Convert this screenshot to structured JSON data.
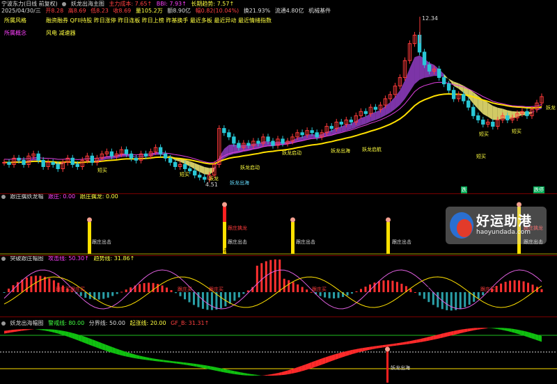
{
  "main": {
    "title_row1": [
      "宁波东力(日线 前复权)",
      "妖龙出海主图",
      "主力成本: 7.65↑",
      "BBI: 7.93↑",
      "长期趋势: 7.57↑"
    ],
    "title_row2": [
      "2025/04/30/三",
      "开8.28",
      "高8.69",
      "低8.23",
      "收8.69",
      "量105.2万",
      "额8.90亿",
      "幅0.82(10.04%)",
      "换21.93%",
      "流通4.80亿",
      "机械基件"
    ],
    "info_labels": [
      "所属风格",
      "所属概念"
    ],
    "style_text": "融资融券 QFII持股 昨日涨停 昨日连板 昨日上榜 昨基换手 最近多板 最近异动 最近情绪指数",
    "concept_text": "风电 减速器",
    "high_label": "12.34",
    "low_label": "4.51",
    "signal_labels": [
      "妖龙出海",
      "妖龙启动",
      "妖龙出海",
      "妖龙启动",
      "妖龙启航",
      "短买",
      "短买",
      "短买",
      "短买",
      "短买",
      "妖龙",
      "妖龙"
    ],
    "bottom_tags": [
      "跌",
      "跌停"
    ],
    "colors": {
      "up": "#ff3b3b",
      "down": "#29c7d6",
      "ma_yellow": "#ffe000",
      "ma_pink": "#e040e0",
      "ribbon_purple": "#8a3ab9",
      "ribbon_yellow": "#e8e070"
    },
    "chart_data": {
      "type": "candlestick",
      "close": [
        5.6,
        5.5,
        5.8,
        5.7,
        5.5,
        5.9,
        6.0,
        5.7,
        5.4,
        5.6,
        5.5,
        5.3,
        5.6,
        5.8,
        5.5,
        5.4,
        5.7,
        5.9,
        5.6,
        5.8,
        6.0,
        6.1,
        5.9,
        6.0,
        6.2,
        6.0,
        5.8,
        5.7,
        6.0,
        5.9,
        6.1,
        6.3,
        6.0,
        5.8,
        5.6,
        5.4,
        5.5,
        5.3,
        5.2,
        5.0,
        4.9,
        4.8,
        5.0,
        5.5,
        7.2,
        7.0,
        6.8,
        6.5,
        6.3,
        6.5,
        6.4,
        6.6,
        6.5,
        6.8,
        6.6,
        6.4,
        6.7,
        6.5,
        6.6,
        6.8,
        7.0,
        6.9,
        7.1,
        7.0,
        6.8,
        7.0,
        7.3,
        7.2,
        7.5,
        7.4,
        7.6,
        7.5,
        7.8,
        8.0,
        7.9,
        8.2,
        8.1,
        8.3,
        8.6,
        8.8,
        9.2,
        9.6,
        10.4,
        11.2,
        11.6,
        10.8,
        10.2,
        9.9,
        10.0,
        9.6,
        9.3,
        9.0,
        8.6,
        8.8,
        8.5,
        8.2,
        7.8,
        7.6,
        7.4,
        7.5,
        7.3,
        7.6,
        7.8,
        7.6,
        7.7,
        7.9,
        8.0,
        7.8,
        8.1,
        8.4,
        8.7
      ]
    }
  },
  "pane2": {
    "title": "跟庄擒妖龙幅",
    "fields": [
      "跟庄: 0.00",
      "跟庄擒龙: 0.00"
    ],
    "labels": [
      "跟庄出击",
      "跟庄出击",
      "跟庄出击",
      "跟庄出击",
      "跟庄出击",
      "跟庄出击"
    ],
    "labels_red": [
      "跟庄擒龙",
      "跟庄擒龙"
    ]
  },
  "pane3": {
    "title": "突破跟庄幅图",
    "fields": [
      "攻击线: 50.30↑",
      "趋势线: 31.86↑"
    ],
    "labels": [
      "跟庄买",
      "跟庄买",
      "跟庄买",
      "跟庄买",
      "跟庄买",
      "跟庄买",
      "跟庄买"
    ]
  },
  "pane4": {
    "title": "妖龙出海幅图",
    "fields": [
      "警戒线: 80.00",
      "分界线: 50.00",
      "起涨线: 20.00",
      "GF_B: 31.31↑"
    ],
    "label": "妖龙出海"
  },
  "watermark": {
    "title": "好运助港",
    "url": "haoyundada.com"
  }
}
